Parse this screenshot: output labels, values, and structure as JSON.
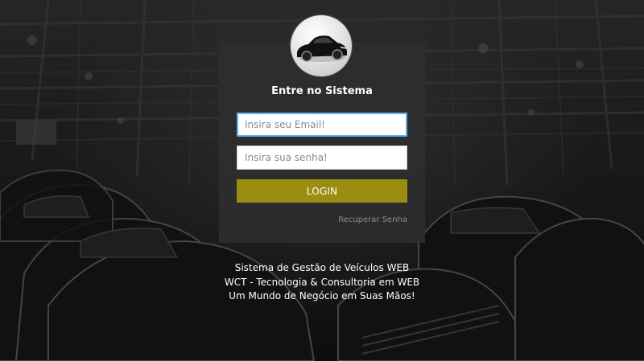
{
  "login": {
    "title": "Entre no Sistema",
    "email_placeholder": "Insira seu Email!",
    "password_placeholder": "Insira sua senha!",
    "button_label": "LOGIN",
    "recover_label": "Recuperar Senha"
  },
  "footer": {
    "line1": "Sistema de Gestão de Veículos WEB",
    "line2": "WCT - Tecnologia & Consultoria em WEB",
    "line3": "Um Mundo de Negócio em Suas Mãos!"
  },
  "colors": {
    "button": "#9b8d0f",
    "card": "#2b2d2e",
    "focus_border": "#66afe9"
  },
  "icons": {
    "avatar": "car-icon",
    "background": "factory-image"
  }
}
